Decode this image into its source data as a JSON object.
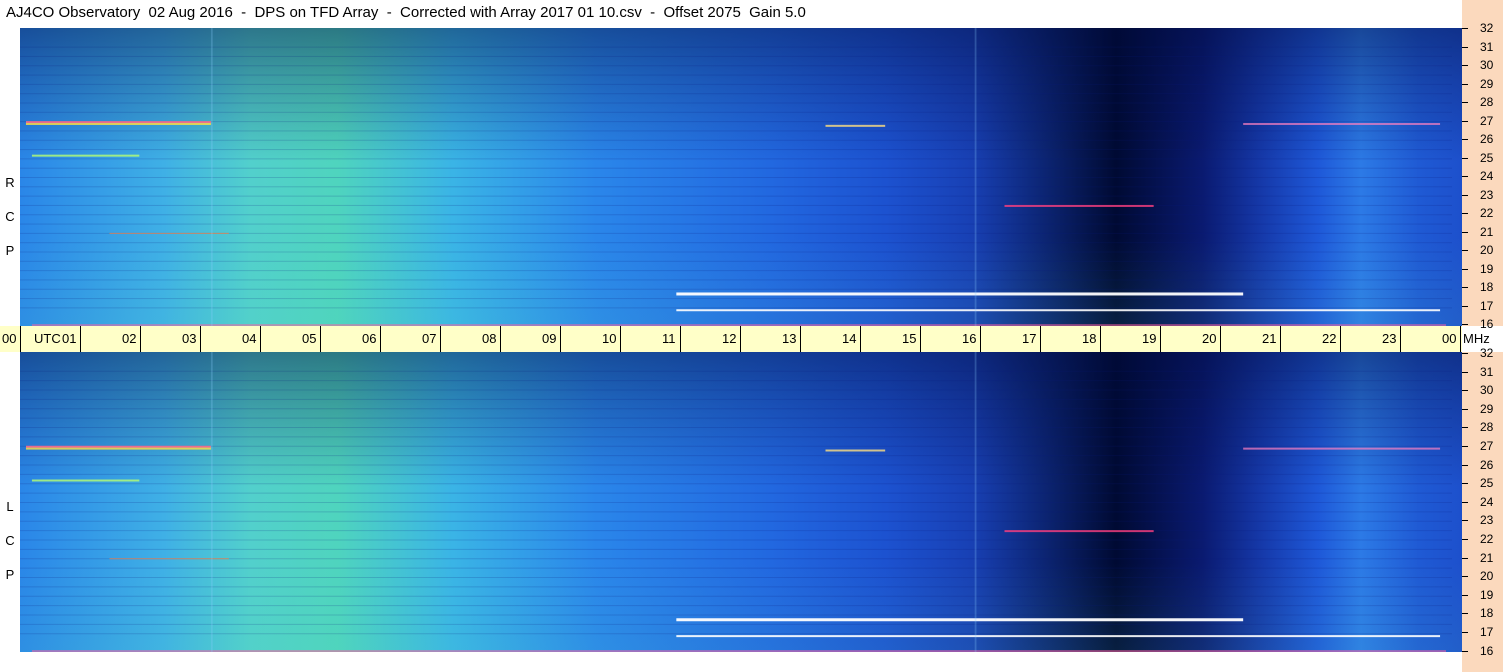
{
  "header": {
    "title": "AJ4CO Observatory  02 Aug 2016  -  DPS on TFD Array  -  Corrected with Array 2017 01 10.csv  -  Offset 2075  Gain 5.0"
  },
  "panels": {
    "top_label": "R\nC\nP",
    "bottom_label": "L\nC\nP"
  },
  "chart_data": {
    "type": "heatmap",
    "title": "AJ4CO Observatory  02 Aug 2016  -  DPS on TFD Array  -  Corrected with Array 2017 01 10.csv  -  Offset 2075  Gain 5.0",
    "x_axis": {
      "ticks": [
        "00",
        "UTC",
        "01",
        "02",
        "03",
        "04",
        "05",
        "06",
        "07",
        "08",
        "09",
        "10",
        "11",
        "12",
        "13",
        "14",
        "15",
        "16",
        "17",
        "18",
        "19",
        "20",
        "21",
        "22",
        "23",
        "00"
      ],
      "range": [
        0,
        24
      ],
      "end_unit": "MHz"
    },
    "y_axis": {
      "ticks": [
        "32",
        "31",
        "30",
        "29",
        "28",
        "27",
        "26",
        "25",
        "24",
        "23",
        "22",
        "21",
        "20",
        "19",
        "18",
        "17",
        "16"
      ],
      "range": [
        16,
        32
      ]
    },
    "subplots": [
      {
        "name": "RCP"
      },
      {
        "name": "LCP"
      }
    ],
    "colors": {
      "low": "#000a33",
      "mid": "#1a5ee0",
      "high": "#59e6b0",
      "peak": "#ffffff"
    },
    "grid": false
  },
  "axis": {
    "time_labels": [
      "00",
      "UTC",
      "01",
      "02",
      "03",
      "04",
      "05",
      "06",
      "07",
      "08",
      "09",
      "10",
      "11",
      "12",
      "13",
      "14",
      "15",
      "16",
      "17",
      "18",
      "19",
      "20",
      "21",
      "22",
      "23",
      "00"
    ],
    "mhz_unit": "MHz",
    "mhz_labels": [
      "32",
      "31",
      "30",
      "29",
      "28",
      "27",
      "26",
      "25",
      "24",
      "23",
      "22",
      "21",
      "20",
      "19",
      "18",
      "17",
      "16"
    ]
  }
}
